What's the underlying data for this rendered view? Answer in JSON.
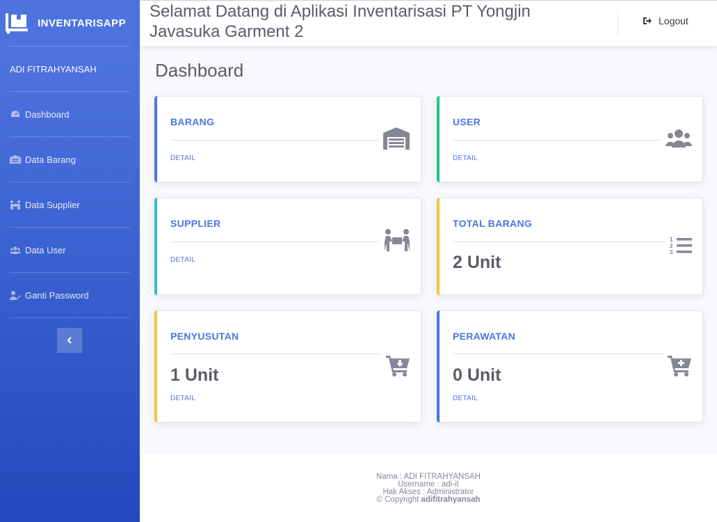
{
  "sidebar": {
    "brand": "INVENTARISAPP",
    "user": "ADI FITRAHYANSAH",
    "items": [
      {
        "label": "Dashboard",
        "icon": "tachometer-icon"
      },
      {
        "label": "Data Barang",
        "icon": "warehouse-icon"
      },
      {
        "label": "Data Supplier",
        "icon": "people-carry-icon"
      },
      {
        "label": "Data User",
        "icon": "users-icon"
      },
      {
        "label": "Ganti Password",
        "icon": "user-edit-icon"
      }
    ]
  },
  "topbar": {
    "title": "Selamat Datang di Aplikasi Inventarisasi PT Yongjin Javasuka Garment 2",
    "logout_label": "Logout"
  },
  "page": {
    "title": "Dashboard"
  },
  "cards": [
    {
      "label": "BARANG",
      "detail": "DETAIL",
      "color": "#4e73df",
      "icon": "warehouse-icon"
    },
    {
      "label": "USER",
      "detail": "DETAIL",
      "color": "#1cc88a",
      "icon": "users-icon"
    },
    {
      "label": "SUPPLIER",
      "detail": "DETAIL",
      "color": "#36b9cc",
      "icon": "people-carry-icon"
    },
    {
      "label": "TOTAL BARANG",
      "value": "2 Unit",
      "color": "#f6c23e",
      "icon": "list-ol-icon"
    },
    {
      "label": "PENYUSUTAN",
      "value": "1 Unit",
      "detail": "DETAIL",
      "color": "#f6c23e",
      "icon": "cart-arrow-down-icon"
    },
    {
      "label": "PERAWATAN",
      "value": "0 Unit",
      "detail": "DETAIL",
      "color": "#4e73df",
      "icon": "cart-plus-icon"
    }
  ],
  "footer": {
    "nama": "Nama : ADI FITRAHYANSAH",
    "username": "Username : adi-it",
    "hak_akses": "Hak Akses : Administrator",
    "copyright_prefix": "© Copyright",
    "copyright_name": "adifitrahyansah"
  }
}
